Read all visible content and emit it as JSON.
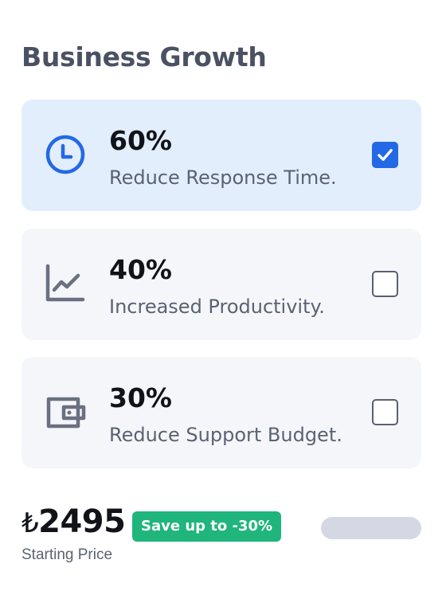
{
  "page": {
    "title": "Business Growth"
  },
  "options": [
    {
      "value": "60%",
      "label": "Reduce Response Time.",
      "icon": "clock-icon",
      "checked": true
    },
    {
      "value": "40%",
      "label": "Increased Productivity.",
      "icon": "chart-line-icon",
      "checked": false
    },
    {
      "value": "30%",
      "label": "Reduce Support Budget.",
      "icon": "wallet-icon",
      "checked": false
    }
  ],
  "pricing": {
    "currency": "₺",
    "amount": "2495",
    "badge": "Save up to -30%",
    "caption": "Starting Price"
  },
  "colors": {
    "accent": "#2369e6",
    "selected_bg": "#e3eefd",
    "card_bg": "#f5f6fa",
    "badge_bg": "#1fb57c",
    "title": "#4a5163",
    "muted_icon": "#6b7080"
  }
}
